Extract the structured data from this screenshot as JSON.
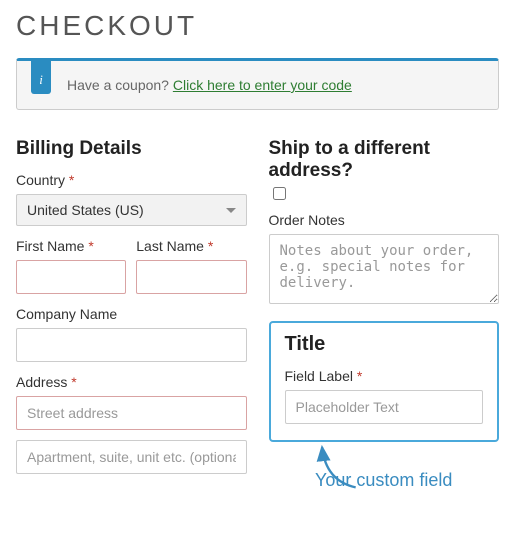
{
  "page_title": "CHECKOUT",
  "coupon": {
    "badge": "i",
    "prompt": "Have a coupon? ",
    "link_text": "Click here to enter your code"
  },
  "billing": {
    "heading": "Billing Details",
    "country_label": "Country",
    "country_value": "United States (US)",
    "first_name_label": "First Name",
    "last_name_label": "Last Name",
    "company_label": "Company Name",
    "address_label": "Address",
    "address_placeholder_1": "Street address",
    "address_placeholder_2": "Apartment, suite, unit etc. (optional)"
  },
  "shipping": {
    "heading": "Ship to a different address?",
    "order_notes_label": "Order Notes",
    "order_notes_placeholder": "Notes about your order, e.g. special notes for delivery."
  },
  "custom_field": {
    "title": "Title",
    "label": "Field Label",
    "placeholder": "Placeholder Text"
  },
  "annotation_text": "Your custom field",
  "required_mark": "*"
}
